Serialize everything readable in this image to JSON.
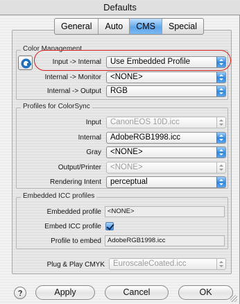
{
  "window": {
    "title": "Defaults"
  },
  "tabs": [
    {
      "label": "General",
      "active": false
    },
    {
      "label": "Auto",
      "active": false
    },
    {
      "label": "CMS",
      "active": true
    },
    {
      "label": "Special",
      "active": false
    }
  ],
  "color_management": {
    "title": "Color Management",
    "input_internal": {
      "label": "Input -> Internal",
      "value": "Use Embedded Profile"
    },
    "internal_monitor": {
      "label": "Internal -> Monitor",
      "value": "<NONE>"
    },
    "internal_output": {
      "label": "Internal -> Output",
      "value": "RGB"
    }
  },
  "profiles": {
    "title": "Profiles for ColorSync",
    "input": {
      "label": "Input",
      "value": "CanonEOS 10D.icc",
      "enabled": false
    },
    "internal": {
      "label": "Internal",
      "value": "AdobeRGB1998.icc",
      "enabled": true
    },
    "gray": {
      "label": "Gray",
      "value": "<NONE>",
      "enabled": true
    },
    "output_printer": {
      "label": "Output/Printer",
      "value": "<NONE>",
      "enabled": false
    },
    "rendering_intent": {
      "label": "Rendering Intent",
      "value": "perceptual",
      "enabled": true
    }
  },
  "embedded": {
    "title": "Embedded ICC profiles",
    "embedded_profile": {
      "label": "Embedded profile",
      "value": "<NONE>"
    },
    "embed_icc": {
      "label": "Embed ICC profile",
      "checked": true
    },
    "profile_to_embed": {
      "label": "Profile to embed",
      "value": "AdobeRGB1998.icc"
    }
  },
  "plug_play": {
    "label": "Plug & Play CMYK",
    "value": "EuroscaleCoated.icc",
    "enabled": false
  },
  "buttons": {
    "apply": "Apply",
    "cancel": "Cancel",
    "ok": "OK"
  },
  "icons": {
    "color_management": "color-management-icon",
    "help": "help-icon",
    "popup_arrows": "updown-arrows-icon",
    "resize": "resize-grip-icon"
  },
  "colors": {
    "accent": "#3c8de2",
    "highlight_annotation": "#d81e1e"
  }
}
